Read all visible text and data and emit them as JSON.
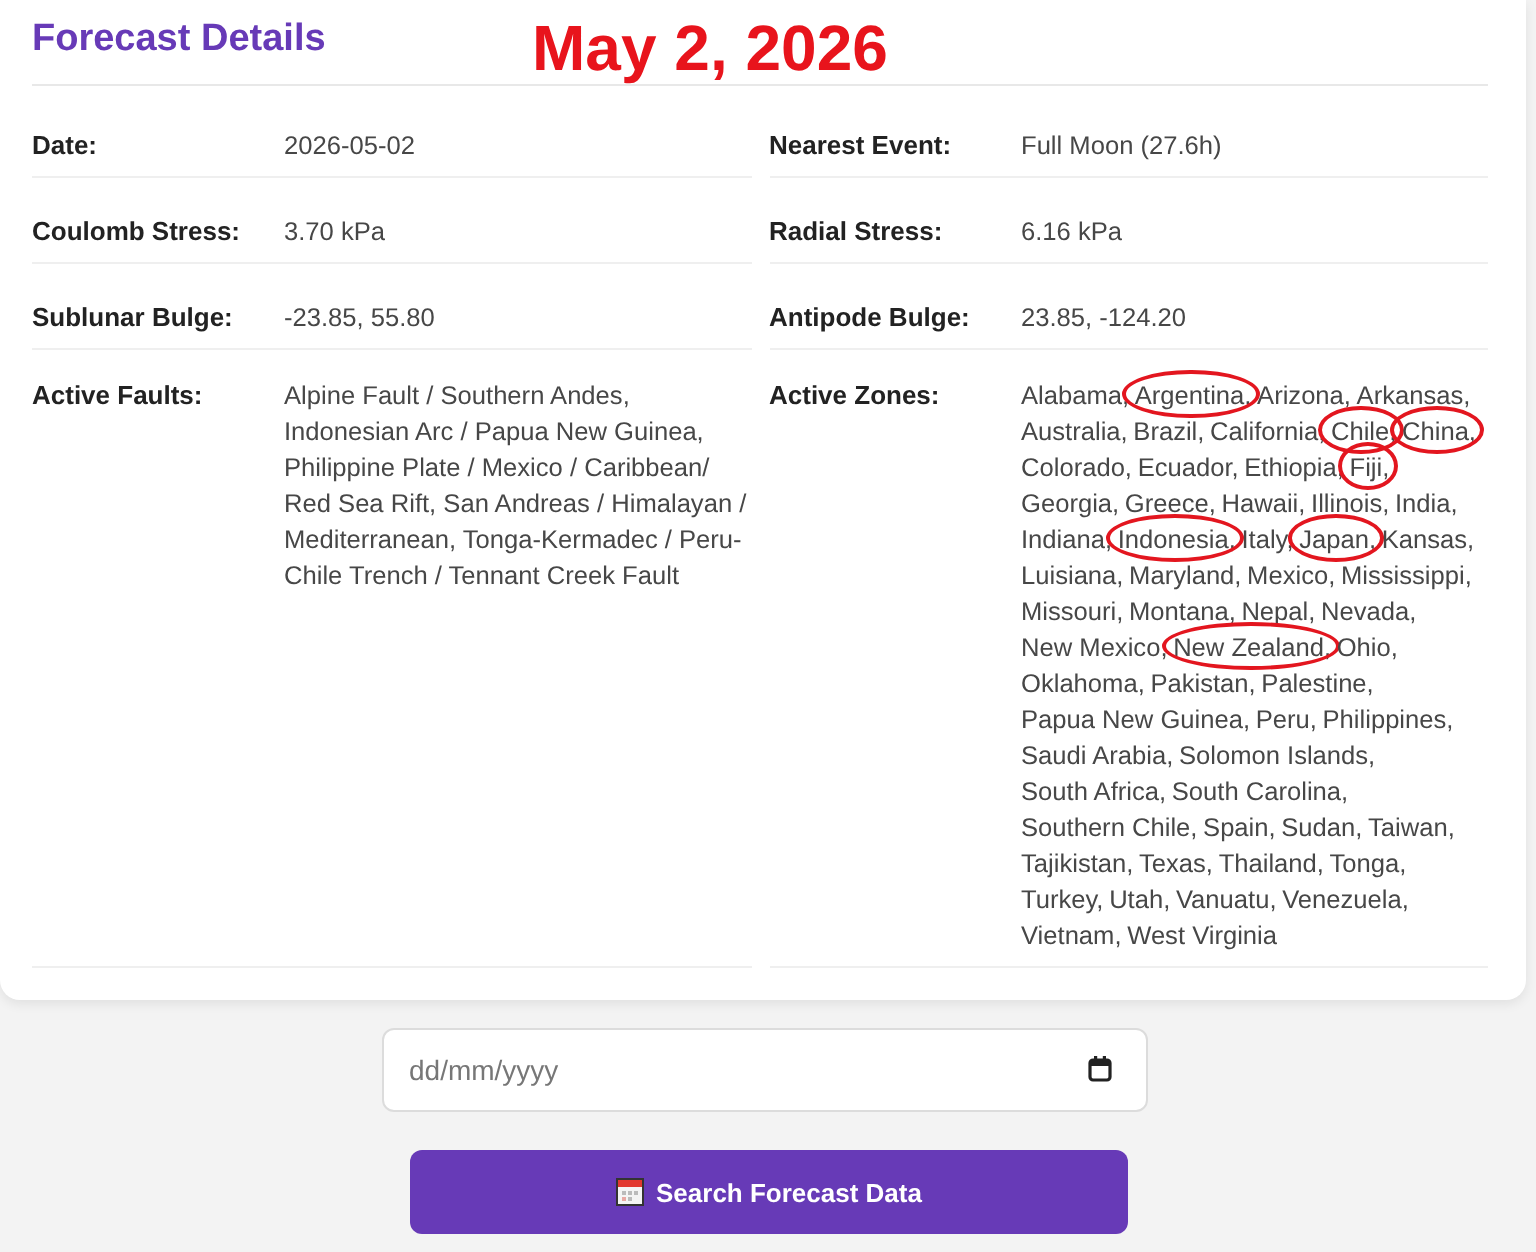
{
  "card": {
    "title": "Forecast Details",
    "annotation": "May 2, 2026",
    "fields": [
      {
        "kind": "text",
        "label": "Date:",
        "value": "2026-05-02"
      },
      {
        "kind": "text",
        "label": "Nearest Event:",
        "value": "Full Moon (27.6h)"
      },
      {
        "kind": "text",
        "label": "Coulomb Stress:",
        "value": "3.70 kPa"
      },
      {
        "kind": "text",
        "label": "Radial Stress:",
        "value": "6.16 kPa"
      },
      {
        "kind": "text",
        "label": "Sublunar Bulge:",
        "value": "-23.85, 55.80"
      },
      {
        "kind": "text",
        "label": "Antipode Bulge:",
        "value": "23.85, -124.20"
      },
      {
        "kind": "text",
        "label": "Active Faults:",
        "value": "Alpine Fault / Southern Andes, Indonesian Arc / Papua New Guinea, Philippine Plate / Mexico / Caribbean/ Red Sea Rift, San Andreas / Himalayan / Mediterranean, Tonga-Kermadec / Peru-Chile Trench / Tennant Creek Fault"
      },
      {
        "kind": "zones",
        "label": "Active Zones:",
        "zones": [
          {
            "name": "Alabama,",
            "circled": false
          },
          {
            "name": "Argentina,",
            "circled": true
          },
          {
            "name": "Arizona,",
            "circled": false
          },
          {
            "name": "Arkansas,",
            "circled": false
          },
          {
            "name": "Australia,",
            "circled": false
          },
          {
            "name": "Brazil,",
            "circled": false
          },
          {
            "name": "California,",
            "circled": false
          },
          {
            "name": "Chile,",
            "circled": true
          },
          {
            "name": "China,",
            "circled": true
          },
          {
            "name": "Colorado,",
            "circled": false
          },
          {
            "name": "Ecuador,",
            "circled": false
          },
          {
            "name": "Ethiopia,",
            "circled": false
          },
          {
            "name": "Fiji,",
            "circled": true
          },
          {
            "name": "Georgia,",
            "circled": false
          },
          {
            "name": "Greece,",
            "circled": false
          },
          {
            "name": "Hawaii,",
            "circled": false
          },
          {
            "name": "Illinois,",
            "circled": false
          },
          {
            "name": "India,",
            "circled": false
          },
          {
            "name": "Indiana,",
            "circled": false
          },
          {
            "name": "Indonesia,",
            "circled": true
          },
          {
            "name": "Italy,",
            "circled": false
          },
          {
            "name": "Japan,",
            "circled": true
          },
          {
            "name": "Kansas,",
            "circled": false
          },
          {
            "name": "Luisiana,",
            "circled": false
          },
          {
            "name": "Maryland,",
            "circled": false
          },
          {
            "name": "Mexico,",
            "circled": false
          },
          {
            "name": "Mississippi,",
            "circled": false
          },
          {
            "name": "Missouri,",
            "circled": false
          },
          {
            "name": "Montana,",
            "circled": false
          },
          {
            "name": "Nepal,",
            "circled": false
          },
          {
            "name": "Nevada,",
            "circled": false
          },
          {
            "name": "New Mexico,",
            "circled": false
          },
          {
            "name": "New Zealand,",
            "circled": true
          },
          {
            "name": "Ohio,",
            "circled": false
          },
          {
            "name": "Oklahoma,",
            "circled": false
          },
          {
            "name": "Pakistan,",
            "circled": false
          },
          {
            "name": "Palestine,",
            "circled": false
          },
          {
            "name": "Papua New Guinea,",
            "circled": false
          },
          {
            "name": "Peru,",
            "circled": false
          },
          {
            "name": "Philippines,",
            "circled": false
          },
          {
            "name": "Saudi Arabia,",
            "circled": false
          },
          {
            "name": "Solomon Islands,",
            "circled": false
          },
          {
            "name": "South Africa,",
            "circled": false
          },
          {
            "name": "South Carolina,",
            "circled": false
          },
          {
            "name": "Southern Chile,",
            "circled": false
          },
          {
            "name": "Spain,",
            "circled": false
          },
          {
            "name": "Sudan,",
            "circled": false
          },
          {
            "name": "Taiwan,",
            "circled": false
          },
          {
            "name": "Tajikistan,",
            "circled": false
          },
          {
            "name": "Texas,",
            "circled": false
          },
          {
            "name": "Thailand,",
            "circled": false
          },
          {
            "name": "Tonga,",
            "circled": false
          },
          {
            "name": "Turkey,",
            "circled": false
          },
          {
            "name": "Utah,",
            "circled": false
          },
          {
            "name": "Vanuatu,",
            "circled": false
          },
          {
            "name": "Venezuela,",
            "circled": false
          },
          {
            "name": "Vietnam,",
            "circled": false
          },
          {
            "name": "West Virginia",
            "circled": false
          }
        ]
      }
    ]
  },
  "date_input": {
    "placeholder": "dd/mm/yyyy"
  },
  "search_button": {
    "label": "Search Forecast Data"
  }
}
